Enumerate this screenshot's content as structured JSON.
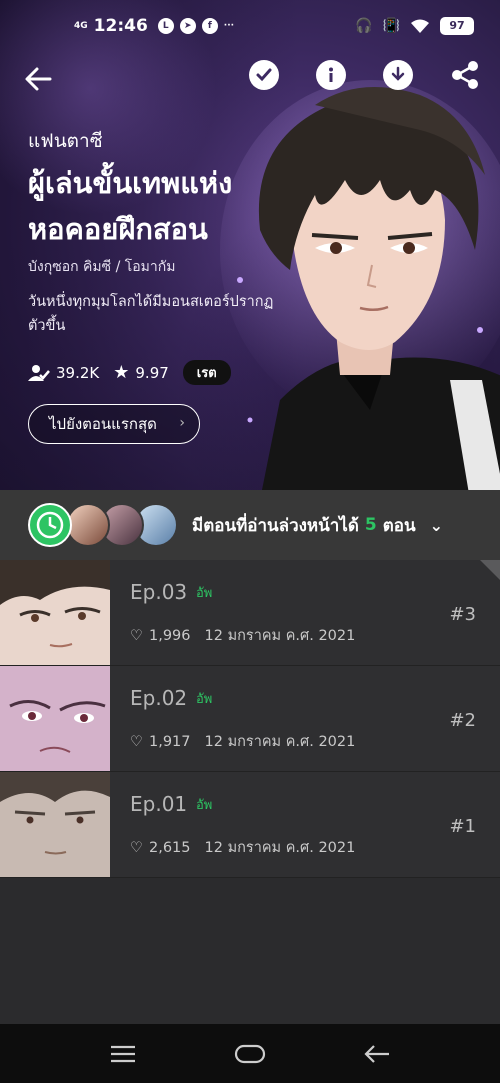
{
  "status_bar": {
    "network": "4G",
    "time": "12:46",
    "battery": "97"
  },
  "header": {
    "genre": "แฟนตาซี",
    "title": "ผู้เล่นขั้นเทพแห่งหอคอยฝึกสอน",
    "author": "บังกุซอก คิมซี / โอมากัม",
    "synopsis": "วันหนึ่งทุกมุมโลกได้มีมอนสเตอร์ปรากฏตัวขึ้น",
    "subscribers": "39.2K",
    "rating": "9.97",
    "rate_label": "เรต",
    "first_episode_button": "ไปยังตอนแรกสุด"
  },
  "preview": {
    "text": "มีตอนที่อ่านล่วงหน้าได้",
    "count": "5",
    "unit": "ตอน"
  },
  "episodes": [
    {
      "title": "Ep.03",
      "badge": "อัพ",
      "likes": "1,996",
      "date": "12 มกราคม ค.ศ. 2021",
      "number": "#3"
    },
    {
      "title": "Ep.02",
      "badge": "อัพ",
      "likes": "1,917",
      "date": "12 มกราคม ค.ศ. 2021",
      "number": "#2"
    },
    {
      "title": "Ep.01",
      "badge": "อัพ",
      "likes": "2,615",
      "date": "12 มกราคม ค.ศ. 2021",
      "number": "#1"
    }
  ],
  "colors": {
    "accent": "#2dc463",
    "hero_bg": "#3d2a62",
    "list_bg": "#2f2f31"
  },
  "icons": {
    "back": "arrow-left-icon",
    "subscribe": "check-icon",
    "info": "info-icon",
    "download": "download-icon",
    "share": "share-icon",
    "clock": "clock-icon",
    "heart": "heart-icon"
  }
}
